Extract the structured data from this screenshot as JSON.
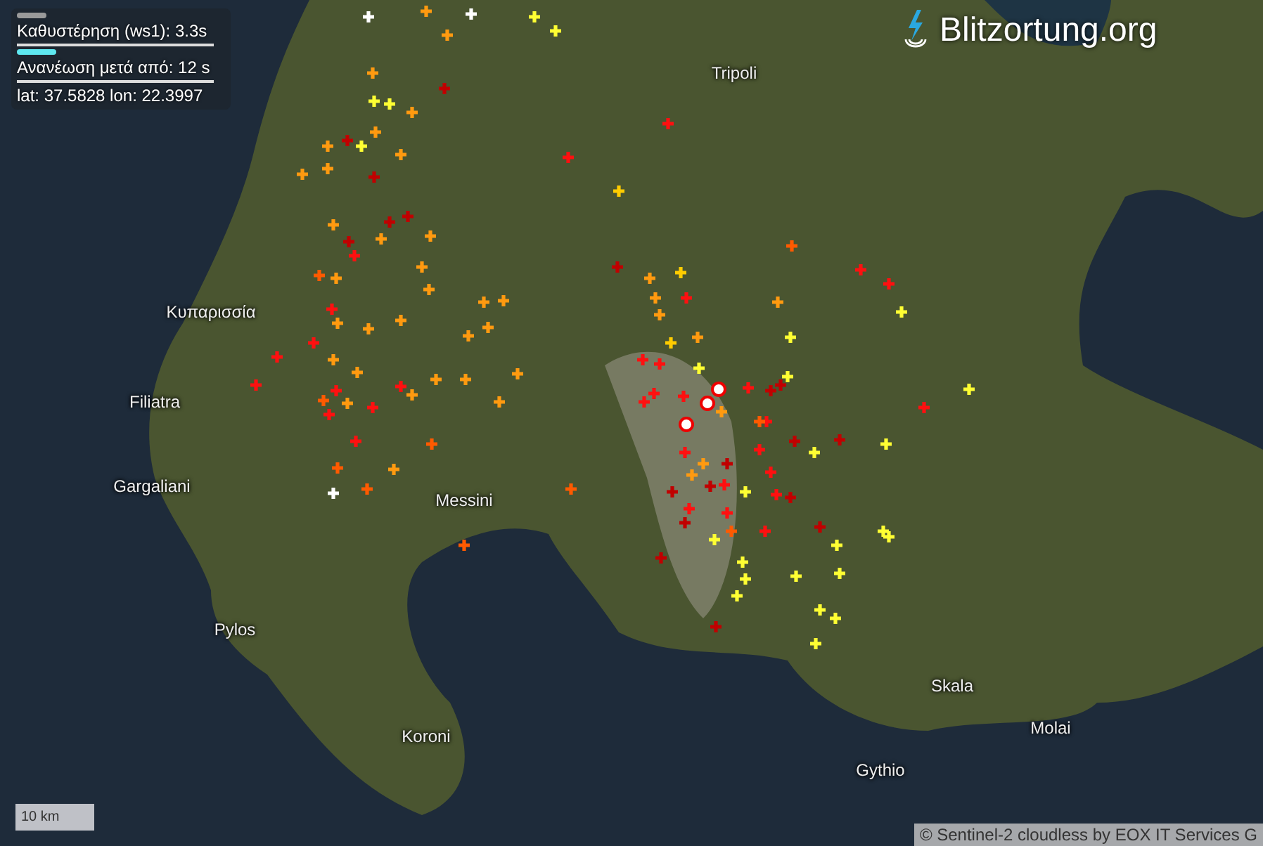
{
  "info_panel": {
    "delay": {
      "label": "Καθυστέρηση (ws1): 3.3s",
      "level": 0.15
    },
    "refresh": {
      "label": "Ανανέωση μετά από: 12 s",
      "level": 0.2
    },
    "coordinates": "lat: 37.5828 lon: 22.3997"
  },
  "logo": {
    "text": "Blitzortung.org"
  },
  "map_labels": [
    "Tripoli",
    "Κυπαρισσία",
    "Filiatra",
    "Gargaliani",
    "Messini",
    "Pylos",
    "Koroni",
    "Skala",
    "Molai",
    "Gythio"
  ],
  "scale": "10 km",
  "attribution": "© Sentinel-2 cloudless by EOX IT Services G"
}
